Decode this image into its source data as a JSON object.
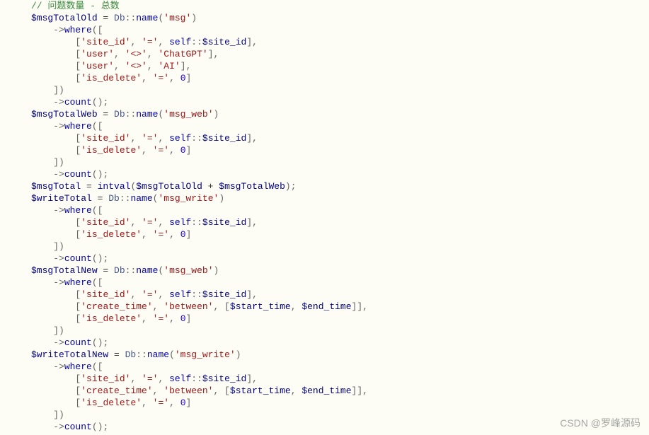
{
  "watermark": "CSDN @罗峰源码",
  "lines": [
    {
      "indent": 0,
      "tokens": [
        {
          "t": "// 问题数量 - 总数",
          "c": "c-comment"
        }
      ]
    },
    {
      "indent": 0,
      "tokens": [
        {
          "t": "$msgTotalOld",
          "c": "c-var"
        },
        {
          "t": " = ",
          "c": "c-text"
        },
        {
          "t": "Db",
          "c": "c-class"
        },
        {
          "t": "::",
          "c": "c-punct"
        },
        {
          "t": "name",
          "c": "c-method"
        },
        {
          "t": "(",
          "c": "c-punct"
        },
        {
          "t": "'msg'",
          "c": "c-string"
        },
        {
          "t": ")",
          "c": "c-punct"
        }
      ]
    },
    {
      "indent": 1,
      "tokens": [
        {
          "t": "->",
          "c": "c-punct"
        },
        {
          "t": "where",
          "c": "c-method"
        },
        {
          "t": "([",
          "c": "c-punct"
        }
      ]
    },
    {
      "indent": 2,
      "tokens": [
        {
          "t": "[",
          "c": "c-punct"
        },
        {
          "t": "'site_id'",
          "c": "c-string"
        },
        {
          "t": ", ",
          "c": "c-punct"
        },
        {
          "t": "'='",
          "c": "c-string"
        },
        {
          "t": ", ",
          "c": "c-punct"
        },
        {
          "t": "self",
          "c": "c-keyword"
        },
        {
          "t": "::",
          "c": "c-punct"
        },
        {
          "t": "$site_id",
          "c": "c-var"
        },
        {
          "t": "],",
          "c": "c-punct"
        }
      ]
    },
    {
      "indent": 2,
      "tokens": [
        {
          "t": "[",
          "c": "c-punct"
        },
        {
          "t": "'user'",
          "c": "c-string"
        },
        {
          "t": ", ",
          "c": "c-punct"
        },
        {
          "t": "'<>'",
          "c": "c-string"
        },
        {
          "t": ", ",
          "c": "c-punct"
        },
        {
          "t": "'ChatGPT'",
          "c": "c-string"
        },
        {
          "t": "],",
          "c": "c-punct"
        }
      ]
    },
    {
      "indent": 2,
      "tokens": [
        {
          "t": "[",
          "c": "c-punct"
        },
        {
          "t": "'user'",
          "c": "c-string"
        },
        {
          "t": ", ",
          "c": "c-punct"
        },
        {
          "t": "'<>'",
          "c": "c-string"
        },
        {
          "t": ", ",
          "c": "c-punct"
        },
        {
          "t": "'AI'",
          "c": "c-string"
        },
        {
          "t": "],",
          "c": "c-punct"
        }
      ]
    },
    {
      "indent": 2,
      "tokens": [
        {
          "t": "[",
          "c": "c-punct"
        },
        {
          "t": "'is_delete'",
          "c": "c-string"
        },
        {
          "t": ", ",
          "c": "c-punct"
        },
        {
          "t": "'='",
          "c": "c-string"
        },
        {
          "t": ", ",
          "c": "c-punct"
        },
        {
          "t": "0",
          "c": "c-num"
        },
        {
          "t": "]",
          "c": "c-punct"
        }
      ]
    },
    {
      "indent": 1,
      "tokens": [
        {
          "t": "])",
          "c": "c-punct"
        }
      ]
    },
    {
      "indent": 1,
      "tokens": [
        {
          "t": "->",
          "c": "c-punct"
        },
        {
          "t": "count",
          "c": "c-method"
        },
        {
          "t": "();",
          "c": "c-punct"
        }
      ]
    },
    {
      "indent": 0,
      "tokens": [
        {
          "t": "$msgTotalWeb",
          "c": "c-var"
        },
        {
          "t": " = ",
          "c": "c-text"
        },
        {
          "t": "Db",
          "c": "c-class"
        },
        {
          "t": "::",
          "c": "c-punct"
        },
        {
          "t": "name",
          "c": "c-method"
        },
        {
          "t": "(",
          "c": "c-punct"
        },
        {
          "t": "'msg_web'",
          "c": "c-string"
        },
        {
          "t": ")",
          "c": "c-punct"
        }
      ]
    },
    {
      "indent": 1,
      "tokens": [
        {
          "t": "->",
          "c": "c-punct"
        },
        {
          "t": "where",
          "c": "c-method"
        },
        {
          "t": "([",
          "c": "c-punct"
        }
      ]
    },
    {
      "indent": 2,
      "tokens": [
        {
          "t": "[",
          "c": "c-punct"
        },
        {
          "t": "'site_id'",
          "c": "c-string"
        },
        {
          "t": ", ",
          "c": "c-punct"
        },
        {
          "t": "'='",
          "c": "c-string"
        },
        {
          "t": ", ",
          "c": "c-punct"
        },
        {
          "t": "self",
          "c": "c-keyword"
        },
        {
          "t": "::",
          "c": "c-punct"
        },
        {
          "t": "$site_id",
          "c": "c-var"
        },
        {
          "t": "],",
          "c": "c-punct"
        }
      ]
    },
    {
      "indent": 2,
      "tokens": [
        {
          "t": "[",
          "c": "c-punct"
        },
        {
          "t": "'is_delete'",
          "c": "c-string"
        },
        {
          "t": ", ",
          "c": "c-punct"
        },
        {
          "t": "'='",
          "c": "c-string"
        },
        {
          "t": ", ",
          "c": "c-punct"
        },
        {
          "t": "0",
          "c": "c-num"
        },
        {
          "t": "]",
          "c": "c-punct"
        }
      ]
    },
    {
      "indent": 1,
      "tokens": [
        {
          "t": "])",
          "c": "c-punct"
        }
      ]
    },
    {
      "indent": 1,
      "tokens": [
        {
          "t": "->",
          "c": "c-punct"
        },
        {
          "t": "count",
          "c": "c-method"
        },
        {
          "t": "();",
          "c": "c-punct"
        }
      ]
    },
    {
      "indent": 0,
      "tokens": [
        {
          "t": "$msgTotal",
          "c": "c-var"
        },
        {
          "t": " = ",
          "c": "c-text"
        },
        {
          "t": "intval",
          "c": "c-func"
        },
        {
          "t": "(",
          "c": "c-punct"
        },
        {
          "t": "$msgTotalOld",
          "c": "c-var"
        },
        {
          "t": " + ",
          "c": "c-text"
        },
        {
          "t": "$msgTotalWeb",
          "c": "c-var"
        },
        {
          "t": ");",
          "c": "c-punct"
        }
      ]
    },
    {
      "indent": 0,
      "tokens": [
        {
          "t": "$writeTotal",
          "c": "c-var"
        },
        {
          "t": " = ",
          "c": "c-text"
        },
        {
          "t": "Db",
          "c": "c-class"
        },
        {
          "t": "::",
          "c": "c-punct"
        },
        {
          "t": "name",
          "c": "c-method"
        },
        {
          "t": "(",
          "c": "c-punct"
        },
        {
          "t": "'msg_write'",
          "c": "c-string"
        },
        {
          "t": ")",
          "c": "c-punct"
        }
      ]
    },
    {
      "indent": 1,
      "tokens": [
        {
          "t": "->",
          "c": "c-punct"
        },
        {
          "t": "where",
          "c": "c-method"
        },
        {
          "t": "([",
          "c": "c-punct"
        }
      ]
    },
    {
      "indent": 2,
      "tokens": [
        {
          "t": "[",
          "c": "c-punct"
        },
        {
          "t": "'site_id'",
          "c": "c-string"
        },
        {
          "t": ", ",
          "c": "c-punct"
        },
        {
          "t": "'='",
          "c": "c-string"
        },
        {
          "t": ", ",
          "c": "c-punct"
        },
        {
          "t": "self",
          "c": "c-keyword"
        },
        {
          "t": "::",
          "c": "c-punct"
        },
        {
          "t": "$site_id",
          "c": "c-var"
        },
        {
          "t": "],",
          "c": "c-punct"
        }
      ]
    },
    {
      "indent": 2,
      "tokens": [
        {
          "t": "[",
          "c": "c-punct"
        },
        {
          "t": "'is_delete'",
          "c": "c-string"
        },
        {
          "t": ", ",
          "c": "c-punct"
        },
        {
          "t": "'='",
          "c": "c-string"
        },
        {
          "t": ", ",
          "c": "c-punct"
        },
        {
          "t": "0",
          "c": "c-num"
        },
        {
          "t": "]",
          "c": "c-punct"
        }
      ]
    },
    {
      "indent": 1,
      "tokens": [
        {
          "t": "])",
          "c": "c-punct"
        }
      ]
    },
    {
      "indent": 1,
      "tokens": [
        {
          "t": "->",
          "c": "c-punct"
        },
        {
          "t": "count",
          "c": "c-method"
        },
        {
          "t": "();",
          "c": "c-punct"
        }
      ]
    },
    {
      "indent": 0,
      "tokens": [
        {
          "t": "$msgTotalNew",
          "c": "c-var"
        },
        {
          "t": " = ",
          "c": "c-text"
        },
        {
          "t": "Db",
          "c": "c-class"
        },
        {
          "t": "::",
          "c": "c-punct"
        },
        {
          "t": "name",
          "c": "c-method"
        },
        {
          "t": "(",
          "c": "c-punct"
        },
        {
          "t": "'msg_web'",
          "c": "c-string"
        },
        {
          "t": ")",
          "c": "c-punct"
        }
      ]
    },
    {
      "indent": 1,
      "tokens": [
        {
          "t": "->",
          "c": "c-punct"
        },
        {
          "t": "where",
          "c": "c-method"
        },
        {
          "t": "([",
          "c": "c-punct"
        }
      ]
    },
    {
      "indent": 2,
      "tokens": [
        {
          "t": "[",
          "c": "c-punct"
        },
        {
          "t": "'site_id'",
          "c": "c-string"
        },
        {
          "t": ", ",
          "c": "c-punct"
        },
        {
          "t": "'='",
          "c": "c-string"
        },
        {
          "t": ", ",
          "c": "c-punct"
        },
        {
          "t": "self",
          "c": "c-keyword"
        },
        {
          "t": "::",
          "c": "c-punct"
        },
        {
          "t": "$site_id",
          "c": "c-var"
        },
        {
          "t": "],",
          "c": "c-punct"
        }
      ]
    },
    {
      "indent": 2,
      "tokens": [
        {
          "t": "[",
          "c": "c-punct"
        },
        {
          "t": "'create_time'",
          "c": "c-string"
        },
        {
          "t": ", ",
          "c": "c-punct"
        },
        {
          "t": "'between'",
          "c": "c-string"
        },
        {
          "t": ", [",
          "c": "c-punct"
        },
        {
          "t": "$start_time",
          "c": "c-var"
        },
        {
          "t": ", ",
          "c": "c-punct"
        },
        {
          "t": "$end_time",
          "c": "c-var"
        },
        {
          "t": "]],",
          "c": "c-punct"
        }
      ]
    },
    {
      "indent": 2,
      "tokens": [
        {
          "t": "[",
          "c": "c-punct"
        },
        {
          "t": "'is_delete'",
          "c": "c-string"
        },
        {
          "t": ", ",
          "c": "c-punct"
        },
        {
          "t": "'='",
          "c": "c-string"
        },
        {
          "t": ", ",
          "c": "c-punct"
        },
        {
          "t": "0",
          "c": "c-num"
        },
        {
          "t": "]",
          "c": "c-punct"
        }
      ]
    },
    {
      "indent": 1,
      "tokens": [
        {
          "t": "])",
          "c": "c-punct"
        }
      ]
    },
    {
      "indent": 1,
      "tokens": [
        {
          "t": "->",
          "c": "c-punct"
        },
        {
          "t": "count",
          "c": "c-method"
        },
        {
          "t": "();",
          "c": "c-punct"
        }
      ]
    },
    {
      "indent": 0,
      "tokens": [
        {
          "t": "$writeTotalNew",
          "c": "c-var"
        },
        {
          "t": " = ",
          "c": "c-text"
        },
        {
          "t": "Db",
          "c": "c-class"
        },
        {
          "t": "::",
          "c": "c-punct"
        },
        {
          "t": "name",
          "c": "c-method"
        },
        {
          "t": "(",
          "c": "c-punct"
        },
        {
          "t": "'msg_write'",
          "c": "c-string"
        },
        {
          "t": ")",
          "c": "c-punct"
        }
      ]
    },
    {
      "indent": 1,
      "tokens": [
        {
          "t": "->",
          "c": "c-punct"
        },
        {
          "t": "where",
          "c": "c-method"
        },
        {
          "t": "([",
          "c": "c-punct"
        }
      ]
    },
    {
      "indent": 2,
      "tokens": [
        {
          "t": "[",
          "c": "c-punct"
        },
        {
          "t": "'site_id'",
          "c": "c-string"
        },
        {
          "t": ", ",
          "c": "c-punct"
        },
        {
          "t": "'='",
          "c": "c-string"
        },
        {
          "t": ", ",
          "c": "c-punct"
        },
        {
          "t": "self",
          "c": "c-keyword"
        },
        {
          "t": "::",
          "c": "c-punct"
        },
        {
          "t": "$site_id",
          "c": "c-var"
        },
        {
          "t": "],",
          "c": "c-punct"
        }
      ]
    },
    {
      "indent": 2,
      "tokens": [
        {
          "t": "[",
          "c": "c-punct"
        },
        {
          "t": "'create_time'",
          "c": "c-string"
        },
        {
          "t": ", ",
          "c": "c-punct"
        },
        {
          "t": "'between'",
          "c": "c-string"
        },
        {
          "t": ", [",
          "c": "c-punct"
        },
        {
          "t": "$start_time",
          "c": "c-var"
        },
        {
          "t": ", ",
          "c": "c-punct"
        },
        {
          "t": "$end_time",
          "c": "c-var"
        },
        {
          "t": "]],",
          "c": "c-punct"
        }
      ]
    },
    {
      "indent": 2,
      "tokens": [
        {
          "t": "[",
          "c": "c-punct"
        },
        {
          "t": "'is_delete'",
          "c": "c-string"
        },
        {
          "t": ", ",
          "c": "c-punct"
        },
        {
          "t": "'='",
          "c": "c-string"
        },
        {
          "t": ", ",
          "c": "c-punct"
        },
        {
          "t": "0",
          "c": "c-num"
        },
        {
          "t": "]",
          "c": "c-punct"
        }
      ]
    },
    {
      "indent": 1,
      "tokens": [
        {
          "t": "])",
          "c": "c-punct"
        }
      ]
    },
    {
      "indent": 1,
      "tokens": [
        {
          "t": "->",
          "c": "c-punct"
        },
        {
          "t": "count",
          "c": "c-method"
        },
        {
          "t": "();",
          "c": "c-punct"
        }
      ]
    }
  ]
}
